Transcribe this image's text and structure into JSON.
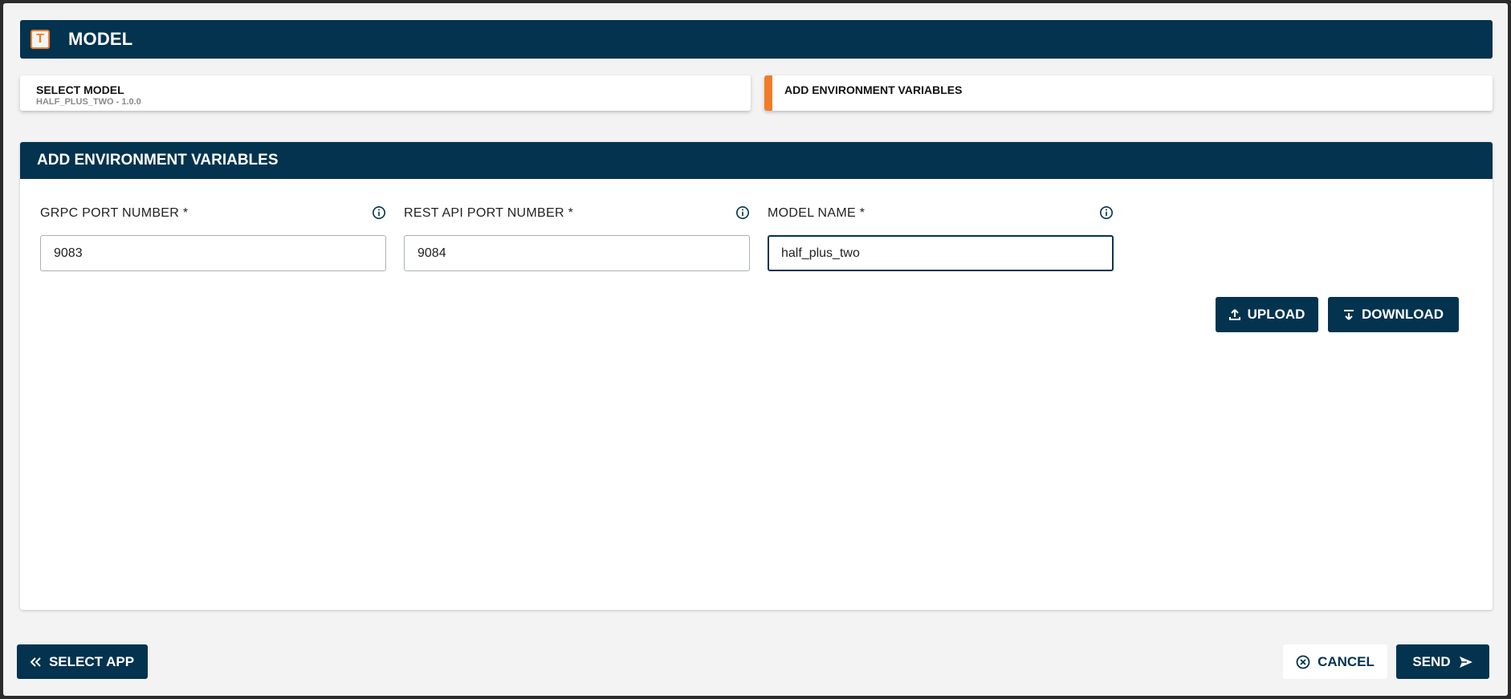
{
  "header": {
    "title": "MODEL",
    "logo_icon": "tensorflow-logo-icon"
  },
  "steps": [
    {
      "title": "SELECT MODEL",
      "subtitle": "HALF_PLUS_TWO - 1.0.0"
    },
    {
      "title": "ADD ENVIRONMENT VARIABLES",
      "subtitle": ""
    }
  ],
  "panel": {
    "title": "ADD ENVIRONMENT VARIABLES",
    "fields": [
      {
        "label": "GRPC PORT NUMBER *",
        "value": "9083"
      },
      {
        "label": "REST API PORT NUMBER *",
        "value": "9084"
      },
      {
        "label": "MODEL NAME *",
        "value": "half_plus_two"
      }
    ],
    "upload_label": "UPLOAD",
    "download_label": "DOWNLOAD"
  },
  "footer": {
    "select_app_label": "SELECT APP",
    "cancel_label": "CANCEL",
    "send_label": "SEND"
  },
  "colors": {
    "primary": "#03334f",
    "accent": "#f07c2a",
    "background": "#f3f3f3"
  }
}
